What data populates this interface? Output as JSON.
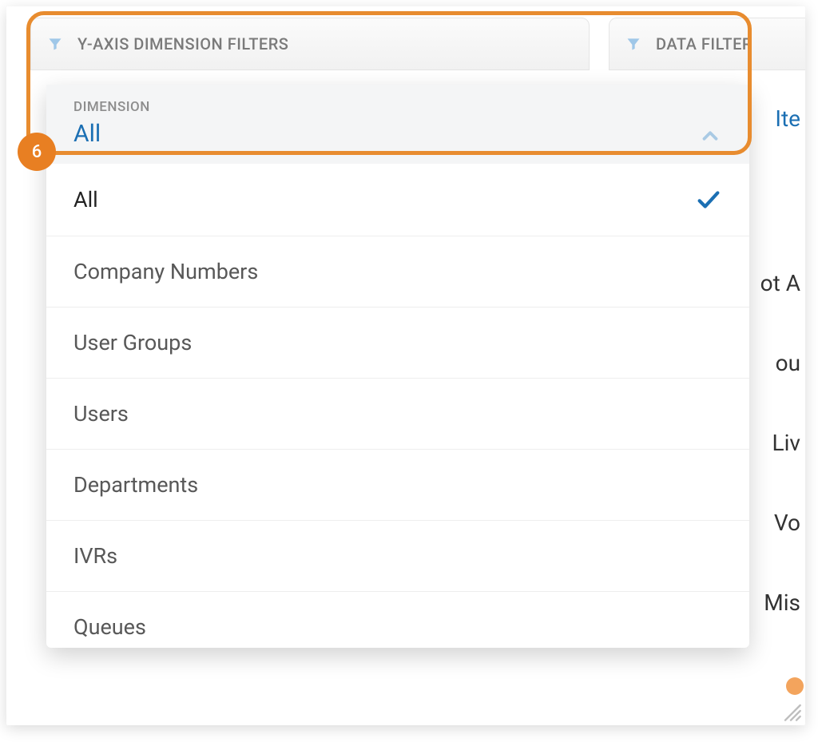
{
  "tabs": {
    "yaxis_label": "Y-AXIS DIMENSION FILTERS",
    "data_label": "DATA FILTER"
  },
  "highlight": {
    "badge_number": "6"
  },
  "dropdown": {
    "label": "DIMENSION",
    "selected": "All",
    "options": [
      {
        "label": "All",
        "selected": true
      },
      {
        "label": "Company Numbers",
        "selected": false
      },
      {
        "label": "User Groups",
        "selected": false
      },
      {
        "label": "Users",
        "selected": false
      },
      {
        "label": "Departments",
        "selected": false
      },
      {
        "label": "IVRs",
        "selected": false
      },
      {
        "label": "Queues",
        "selected": false
      }
    ]
  },
  "background": {
    "items_link": "Ite",
    "rows": [
      "ot A",
      "ou",
      "Liv",
      "Vo",
      "Mis"
    ]
  }
}
